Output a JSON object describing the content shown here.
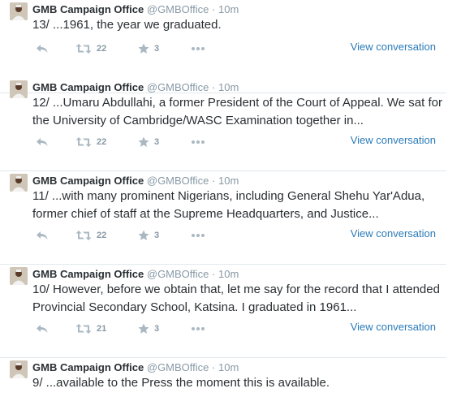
{
  "tweets": [
    {
      "name": "GMB Campaign Office",
      "handle": "@GMBOffice",
      "time": "10m",
      "text": "13/ ...1961, the year we graduated.",
      "retweets": "22",
      "favorites": "3",
      "view_label": "View conversation"
    },
    {
      "name": "GMB Campaign Office",
      "handle": "@GMBOffice",
      "time": "10m",
      "text": "12/ ...Umaru Abdullahi, a former President of the Court of Appeal. We sat for the University of Cambridge/WASC Examination together in...",
      "retweets": "22",
      "favorites": "3",
      "view_label": "View conversation"
    },
    {
      "name": "GMB Campaign Office",
      "handle": "@GMBOffice",
      "time": "10m",
      "text": "11/ ...with many prominent Nigerians, including General Shehu Yar'Adua, former chief of staff at the Supreme Headquarters, and Justice...",
      "retweets": "22",
      "favorites": "3",
      "view_label": "View conversation"
    },
    {
      "name": "GMB Campaign Office",
      "handle": "@GMBOffice",
      "time": "10m",
      "text": "10/ However, before we obtain that, let me say for the record that I attended Provincial Secondary School, Katsina. I graduated in 1961...",
      "retweets": "21",
      "favorites": "3",
      "view_label": "View conversation"
    },
    {
      "name": "GMB Campaign Office",
      "handle": "@GMBOffice",
      "time": "10m",
      "text": "9/ ...available to the Press the moment this is available.",
      "retweets": "",
      "favorites": "",
      "view_label": ""
    }
  ],
  "separator": "·",
  "icons": [
    "reply-icon",
    "retweet-icon",
    "favorite-icon",
    "more-icon"
  ],
  "colors": {
    "icon": "#aab8c2",
    "link": "#2b7bb9",
    "meta": "#8899a6",
    "text": "#292f33"
  }
}
